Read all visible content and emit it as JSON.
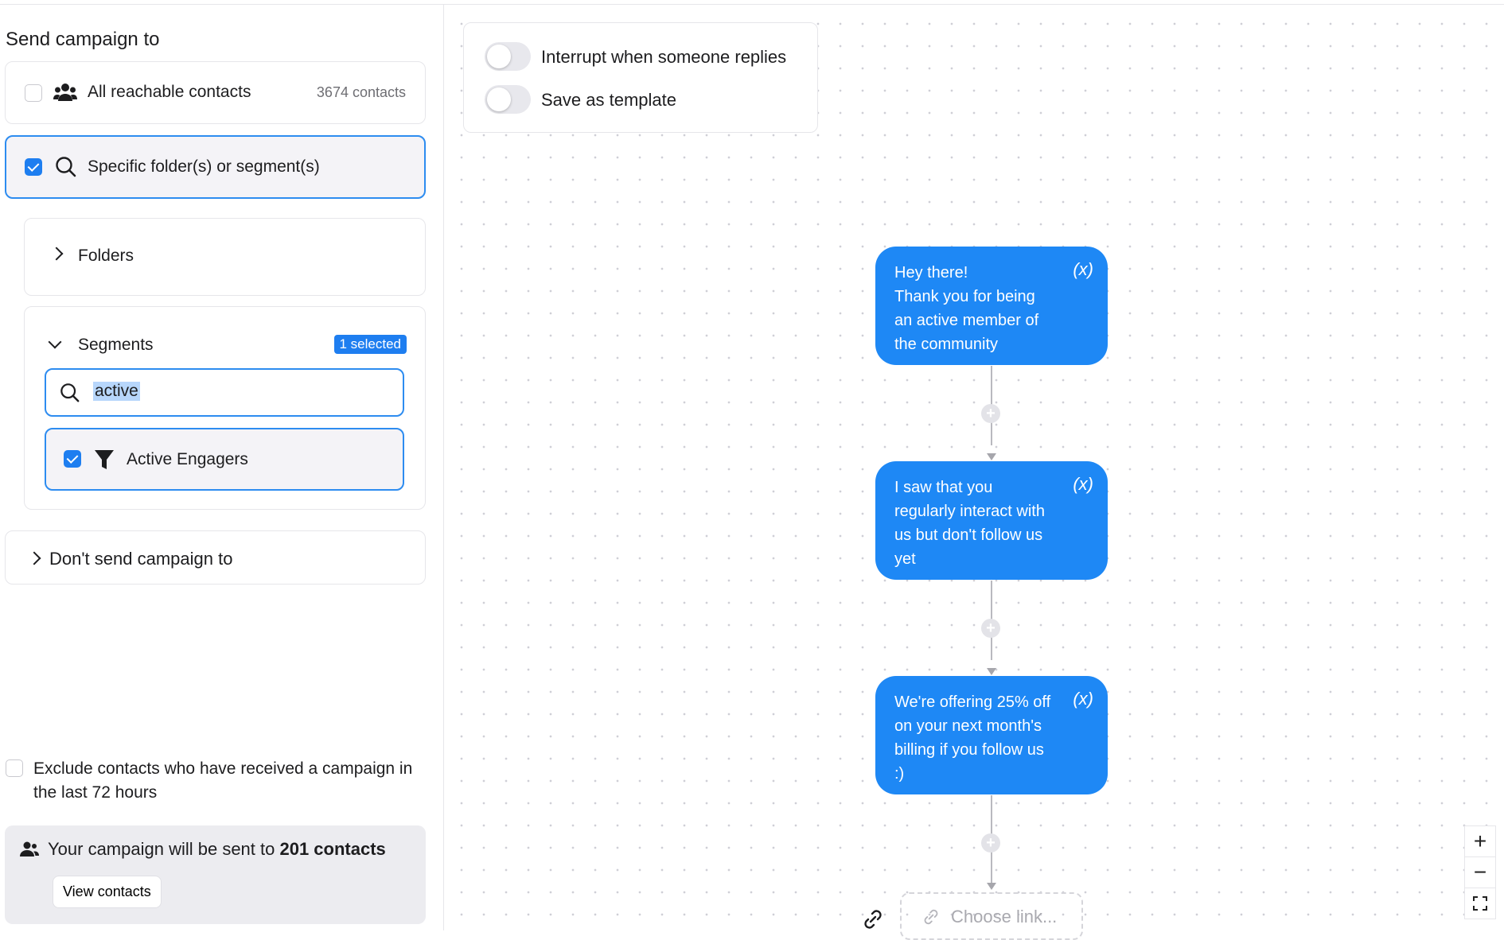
{
  "left": {
    "title": "Send campaign to",
    "all_contacts": {
      "label": "All reachable contacts",
      "count": "3674 contacts",
      "checked": false
    },
    "specific": {
      "label": "Specific folder(s) or segment(s)",
      "checked": true
    },
    "folders": {
      "label": "Folders"
    },
    "segments": {
      "label": "Segments",
      "badge": "1 selected",
      "search_value": "active",
      "results": [
        {
          "label": "Active Engagers",
          "checked": true,
          "icon": "funnel-icon"
        }
      ]
    },
    "dont_send": {
      "label": "Don't send campaign to"
    },
    "exclude": {
      "label": "Exclude contacts who have received a campaign in the last 72 hours",
      "checked": false
    },
    "summary": {
      "prefix": "Your campaign will be sent to ",
      "count": "201 contacts",
      "button": "View contacts"
    }
  },
  "settings": {
    "interrupt": {
      "label": "Interrupt when someone replies",
      "on": false
    },
    "template": {
      "label": "Save as template",
      "on": false
    }
  },
  "flow": {
    "messages": [
      {
        "text": "Hey there!\nThank you for being an active member of the community",
        "var": "(x)"
      },
      {
        "text": "I saw that you regularly interact with us but don't follow us yet",
        "var": "(x)"
      },
      {
        "text": "We're offering 25% off on your next month's billing if you follow us :)",
        "var": "(x)"
      }
    ],
    "choose_link": "Choose link..."
  },
  "zoom_controls": {
    "zoom_in": "+",
    "zoom_out": "−",
    "fit": "fit-screen-icon"
  },
  "colors": {
    "accent": "#1e7ef0",
    "bubble": "#1e88f5"
  }
}
